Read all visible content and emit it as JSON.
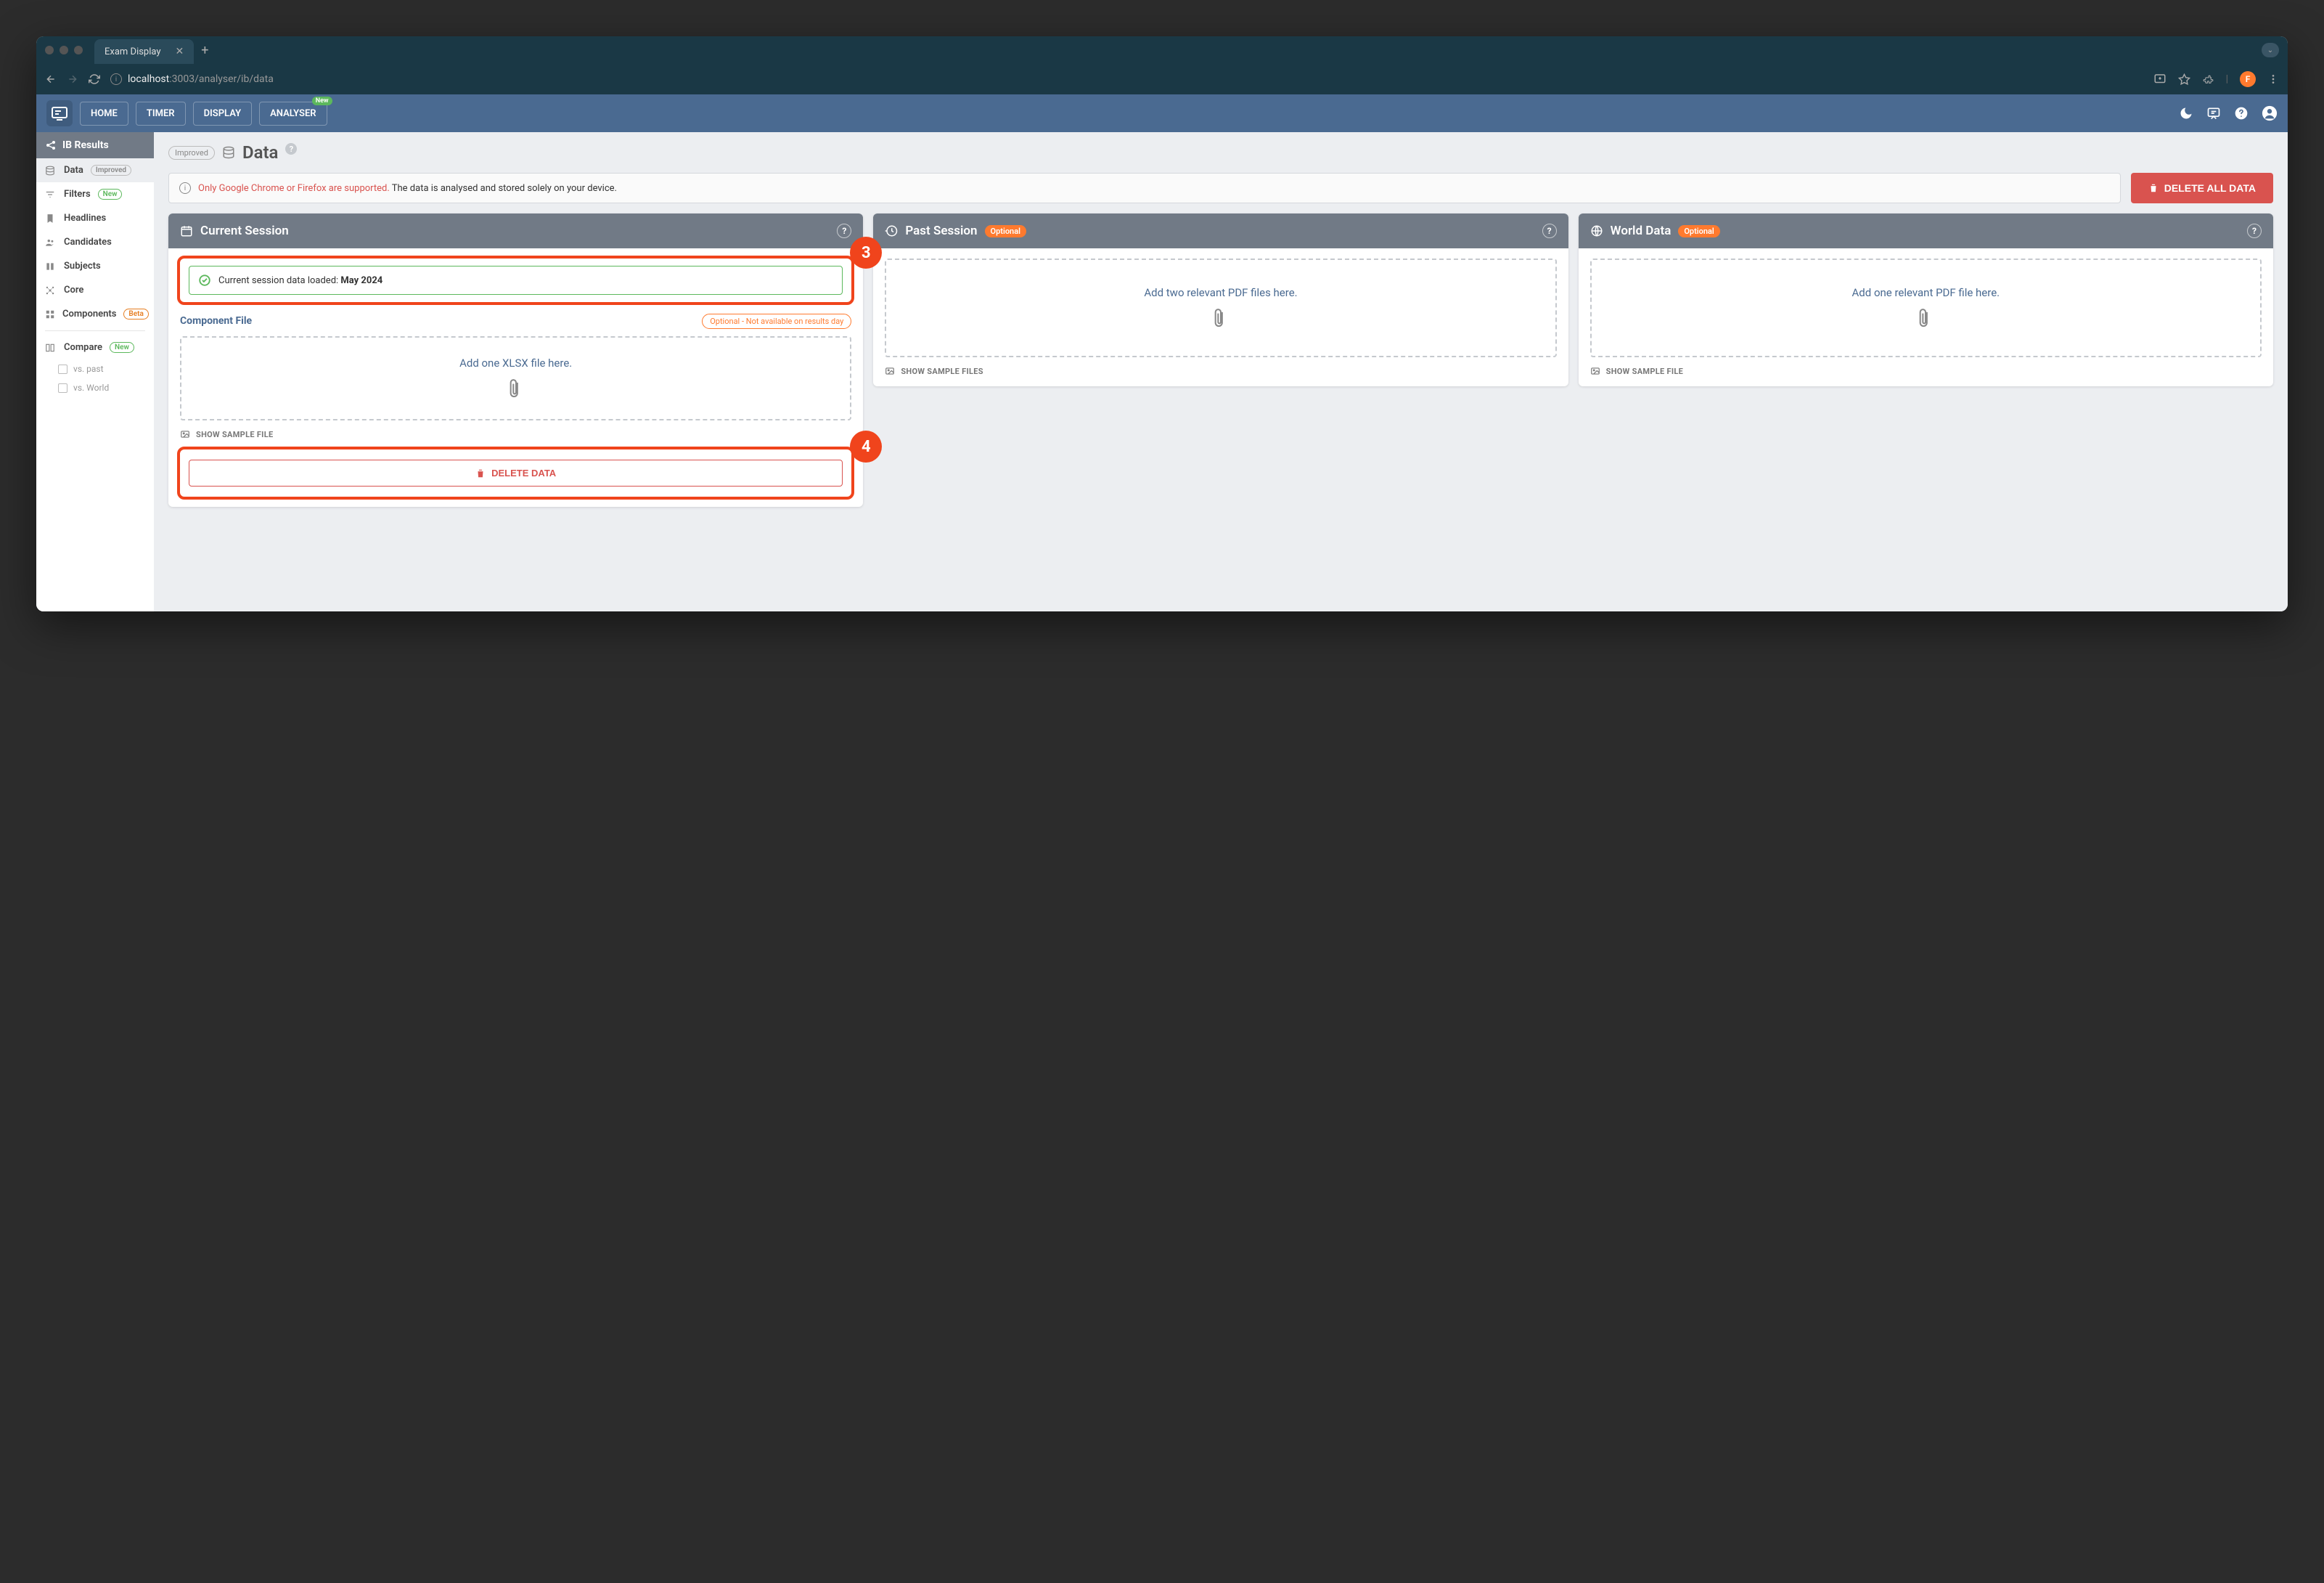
{
  "browser": {
    "tab_title": "Exam Display",
    "url_host": "localhost",
    "url_port": ":3003",
    "url_path": "/analyser/ib/data",
    "avatar_letter": "F"
  },
  "header": {
    "nav": [
      "HOME",
      "TIMER",
      "DISPLAY",
      "ANALYSER"
    ],
    "nav_badge": "New"
  },
  "sidebar": {
    "title": "IB Results",
    "items": [
      {
        "label": "Data",
        "badge": "Improved",
        "badge_class": "improved"
      },
      {
        "label": "Filters",
        "badge": "New",
        "badge_class": "new"
      },
      {
        "label": "Headlines"
      },
      {
        "label": "Candidates"
      },
      {
        "label": "Subjects"
      },
      {
        "label": "Core"
      },
      {
        "label": "Components",
        "badge": "Beta",
        "badge_class": "beta"
      }
    ],
    "compare": {
      "label": "Compare",
      "badge": "New",
      "badge_class": "new"
    },
    "subs": [
      "vs. past",
      "vs. World"
    ]
  },
  "page": {
    "header_badge": "Improved",
    "title": "Data",
    "banner_red": "Only Google Chrome or Firefox are supported.",
    "banner_rest": " The data is analysed and stored solely on your device.",
    "delete_all": "DELETE ALL DATA"
  },
  "cards": {
    "current": {
      "title": "Current Session",
      "loaded_prefix": "Current session data loaded: ",
      "loaded_bold": "May 2024",
      "component_label": "Component File",
      "component_badge": "Optional - Not available on results day",
      "dropzone": "Add one XLSX file here.",
      "show_sample": "SHOW SAMPLE FILE",
      "delete": "DELETE DATA",
      "callout": "3"
    },
    "past": {
      "title": "Past Session",
      "badge": "Optional",
      "dropzone": "Add two relevant PDF files here.",
      "show_sample": "SHOW SAMPLE FILES"
    },
    "world": {
      "title": "World Data",
      "badge": "Optional",
      "dropzone": "Add one relevant PDF file here.",
      "show_sample": "SHOW SAMPLE FILE"
    },
    "callout4": "4"
  }
}
